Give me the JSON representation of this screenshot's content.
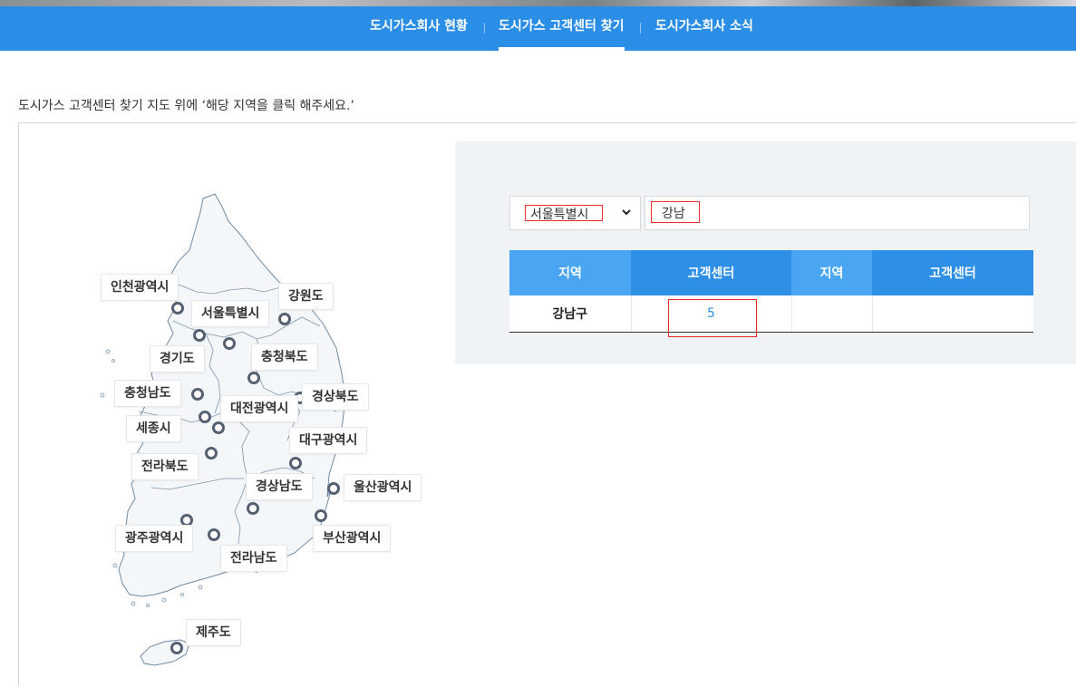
{
  "nav": {
    "items": [
      {
        "label": "도시가스회사 현황"
      },
      {
        "label": "도시가스 고객센터 찾기"
      },
      {
        "label": "도시가스회사 소식"
      }
    ]
  },
  "instruction": "도시가스 고객센터 찾기 지도 위에 ‘해당 지역을 클릭 해주세요.’",
  "map": {
    "regions": [
      {
        "label": "인천광역시"
      },
      {
        "label": "서울특별시"
      },
      {
        "label": "강원도"
      },
      {
        "label": "경기도"
      },
      {
        "label": "충청북도"
      },
      {
        "label": "충청남도"
      },
      {
        "label": "대전광역시"
      },
      {
        "label": "경상북도"
      },
      {
        "label": "세종시"
      },
      {
        "label": "대구광역시"
      },
      {
        "label": "전라북도"
      },
      {
        "label": "경상남도"
      },
      {
        "label": "울산광역시"
      },
      {
        "label": "광주광역시"
      },
      {
        "label": "부산광역시"
      },
      {
        "label": "전라남도"
      },
      {
        "label": "제주도"
      }
    ]
  },
  "search": {
    "city_select_value": "서울특별시",
    "keyword_value": "강남"
  },
  "results": {
    "headers": [
      "지역",
      "고객센터",
      "지역",
      "고객센터"
    ],
    "rows": [
      {
        "area": "강남구",
        "count": "5",
        "area2": "",
        "count2": ""
      }
    ]
  },
  "colors": {
    "nav_bg": "#2b8ee6",
    "header_light": "#4aa6f2",
    "header_dark": "#2e8fe6",
    "panel_bg": "#f0f3f6",
    "highlight_box": "#ee2a2a"
  },
  "icons": {
    "select_chevron": "chevron-down-icon",
    "region_marker": "location-marker-icon"
  }
}
